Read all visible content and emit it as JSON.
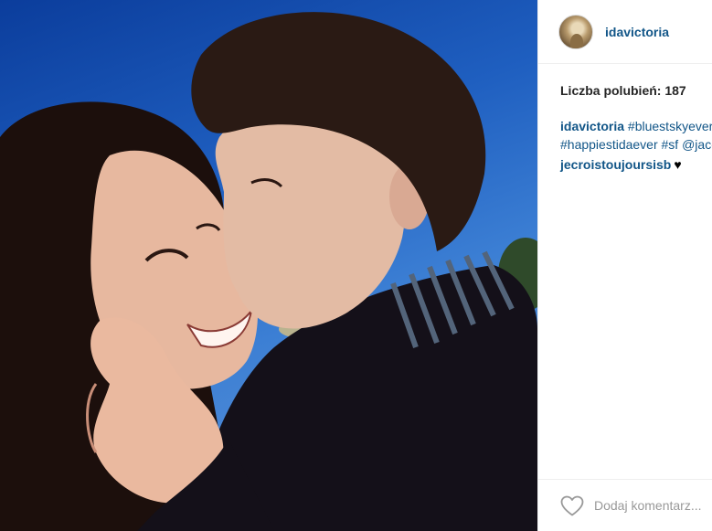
{
  "post": {
    "username": "idavictoria",
    "likes_text": "Liczba polubień: 187",
    "caption": {
      "user": "idavictoria",
      "line1_tags": "#bluestskyever",
      "line2_tags": "#happiestidaever #sf @jaco"
    },
    "comments": [
      {
        "user": "jecroistoujoursisb",
        "text": "♥"
      }
    ],
    "comment_placeholder": "Dodaj komentarz..."
  },
  "icons": {
    "like": "heart-outline-icon",
    "comment_heart": "black-heart-emoji"
  }
}
